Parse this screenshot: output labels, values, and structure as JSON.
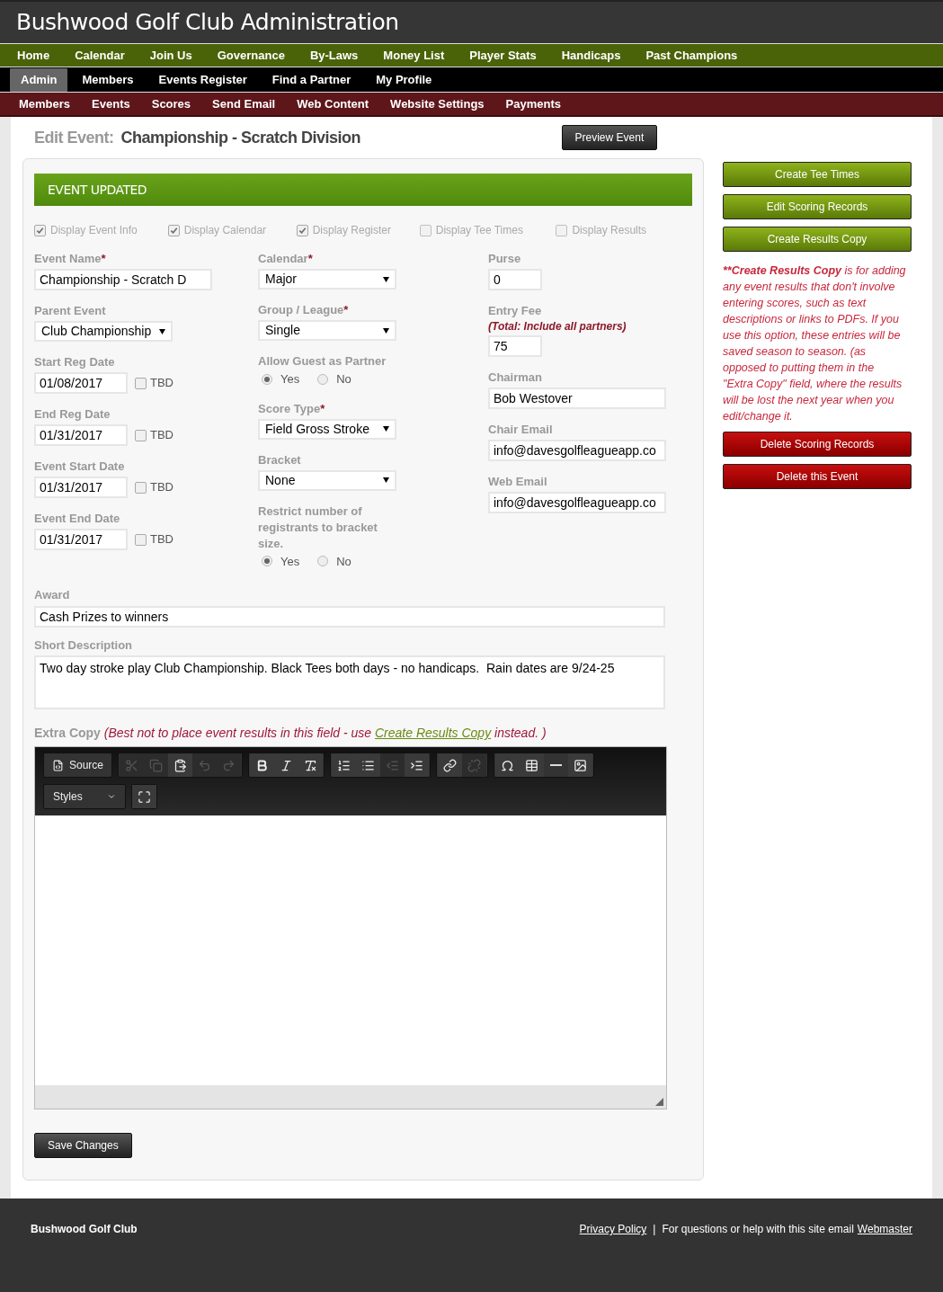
{
  "header": {
    "title": "Bushwood Golf Club Administration"
  },
  "nav_main": [
    {
      "label": "Home"
    },
    {
      "label": "Calendar"
    },
    {
      "label": "Join Us"
    },
    {
      "label": "Governance"
    },
    {
      "label": "By-Laws"
    },
    {
      "label": "Money List"
    },
    {
      "label": "Player Stats"
    },
    {
      "label": "Handicaps"
    },
    {
      "label": "Past Champions"
    }
  ],
  "nav_user": [
    {
      "label": "Admin",
      "selected": true
    },
    {
      "label": "Members",
      "selected": false
    },
    {
      "label": "Events Register",
      "selected": false
    },
    {
      "label": "Find a Partner",
      "selected": false
    },
    {
      "label": "My Profile",
      "selected": false
    }
  ],
  "nav_admin": [
    {
      "label": "Members"
    },
    {
      "label": "Events"
    },
    {
      "label": "Scores"
    },
    {
      "label": "Send Email"
    },
    {
      "label": "Web Content"
    },
    {
      "label": "Website Settings"
    },
    {
      "label": "Payments"
    }
  ],
  "page": {
    "title_label": "Edit Event:",
    "title": "Championship - Scratch Division",
    "preview_button": "Preview Event"
  },
  "alert": "EVENT UPDATED",
  "display_options": [
    {
      "label": "Display Event Info",
      "checked": true
    },
    {
      "label": "Display Calendar",
      "checked": true
    },
    {
      "label": "Display Register",
      "checked": true
    },
    {
      "label": "Display Tee Times",
      "checked": false
    },
    {
      "label": "Display Results",
      "checked": false
    }
  ],
  "columns": [
    [
      {
        "kind": "text",
        "label": "Event Name",
        "required_mark": "*",
        "value": "Championship - Scratch D"
      },
      {
        "kind": "select",
        "label": "Parent Event",
        "value": "Club Championship"
      },
      {
        "kind": "date",
        "label": "Start Reg Date",
        "value": "01/08/2017",
        "tbd_label": "TBD",
        "tbd_checked": false
      },
      {
        "kind": "date",
        "label": "End Reg Date",
        "value": "01/31/2017",
        "tbd_label": "TBD",
        "tbd_checked": false
      },
      {
        "kind": "date",
        "label": "Event Start Date",
        "value": "01/31/2017",
        "tbd_label": "TBD",
        "tbd_checked": false
      },
      {
        "kind": "date",
        "label": "Event End Date",
        "value": "01/31/2017",
        "tbd_label": "TBD",
        "tbd_checked": false
      }
    ],
    [
      {
        "kind": "select",
        "label": "Calendar",
        "required_mark": "*",
        "value": "Major"
      },
      {
        "kind": "select",
        "label": "Group / League",
        "required_mark": "*",
        "value": "Single"
      },
      {
        "kind": "radio",
        "label": "Allow Guest as Partner",
        "options": [
          {
            "label": "Yes",
            "selected": true
          },
          {
            "label": "No",
            "selected": false
          }
        ]
      },
      {
        "kind": "select",
        "label": "Score Type",
        "required_mark": "*",
        "value": "Field Gross Stroke"
      },
      {
        "kind": "select",
        "label": "Bracket",
        "value": "None"
      },
      {
        "kind": "radio",
        "label": "Restrict number of registrants to bracket size.",
        "options": [
          {
            "label": "Yes",
            "selected": true
          },
          {
            "label": "No",
            "selected": false
          }
        ]
      }
    ],
    [
      {
        "kind": "short",
        "label": "Purse",
        "value": "0"
      },
      {
        "kind": "short",
        "label": "Entry Fee",
        "note": "(Total: Include all partners)",
        "value": "75"
      },
      {
        "kind": "text",
        "label": "Chairman",
        "value": "Bob Westover"
      },
      {
        "kind": "text",
        "label": "Chair Email",
        "value": "info@davesgolfleagueapp.co"
      },
      {
        "kind": "text",
        "label": "Web Email",
        "value": "info@davesgolfleagueapp.co"
      }
    ]
  ],
  "award": {
    "label": "Award",
    "value": "Cash Prizes to winners"
  },
  "short_description": {
    "label": "Short Description",
    "value": "Two day stroke play Club Championship. Black Tees both days - no handicaps.  Rain dates are 9/24-25"
  },
  "extra_copy": {
    "label": "Extra Copy",
    "note_before": "(Best not to place event results in this field - use",
    "link": "Create Results Copy",
    "note_after": "instead. )"
  },
  "editor": {
    "toolbar": [
      [
        {
          "kind": "source",
          "label": "Source",
          "disabled": false
        }
      ],
      [
        {
          "kind": "cut",
          "disabled": true
        },
        {
          "kind": "copy",
          "disabled": true
        },
        {
          "kind": "paste",
          "disabled": false
        },
        {
          "kind": "undo",
          "disabled": true
        },
        {
          "kind": "redo",
          "disabled": true
        }
      ],
      [
        {
          "kind": "bold",
          "disabled": false
        },
        {
          "kind": "italic",
          "disabled": false
        },
        {
          "kind": "clear-format",
          "disabled": false
        }
      ],
      [
        {
          "kind": "numbered-list",
          "disabled": false
        },
        {
          "kind": "bullet-list",
          "disabled": false
        },
        {
          "kind": "outdent",
          "disabled": true
        },
        {
          "kind": "indent",
          "disabled": false
        }
      ],
      [
        {
          "kind": "link",
          "disabled": false
        },
        {
          "kind": "unlink",
          "disabled": true
        }
      ],
      [
        {
          "kind": "omega",
          "disabled": false
        },
        {
          "kind": "table",
          "disabled": false
        },
        {
          "kind": "rule",
          "disabled": false
        },
        {
          "kind": "image",
          "disabled": false
        }
      ],
      [
        {
          "kind": "styles",
          "label": "Styles",
          "disabled": false
        }
      ],
      [
        {
          "kind": "maximize",
          "disabled": false
        }
      ]
    ]
  },
  "save_button": "Save Changes",
  "sidebar": {
    "buttons_top": [
      {
        "label": "Create Tee Times",
        "kind": "primary"
      },
      {
        "label": "Edit Scoring Records",
        "kind": "primary"
      },
      {
        "label": "Create Results Copy",
        "kind": "primary"
      }
    ],
    "note_mark": "**",
    "note_bold": "Create Results Copy",
    "note_text": " is for adding any event results that don't involve entering scores, such as text descriptions or links to PDFs. If you use this option, these entries will be saved season to season. (as opposed to putting them in the \"Extra Copy\" field, where the results will be lost the next year when you edit/change it.",
    "buttons_bottom": [
      {
        "label": "Delete Scoring Records",
        "kind": "danger"
      },
      {
        "label": "Delete this Event",
        "kind": "danger"
      }
    ]
  },
  "footer": {
    "name": "Bushwood Golf Club",
    "privacy": "Privacy Policy",
    "separator": "|",
    "contact_text": "For questions or help with this site email",
    "webmaster": "Webmaster"
  }
}
